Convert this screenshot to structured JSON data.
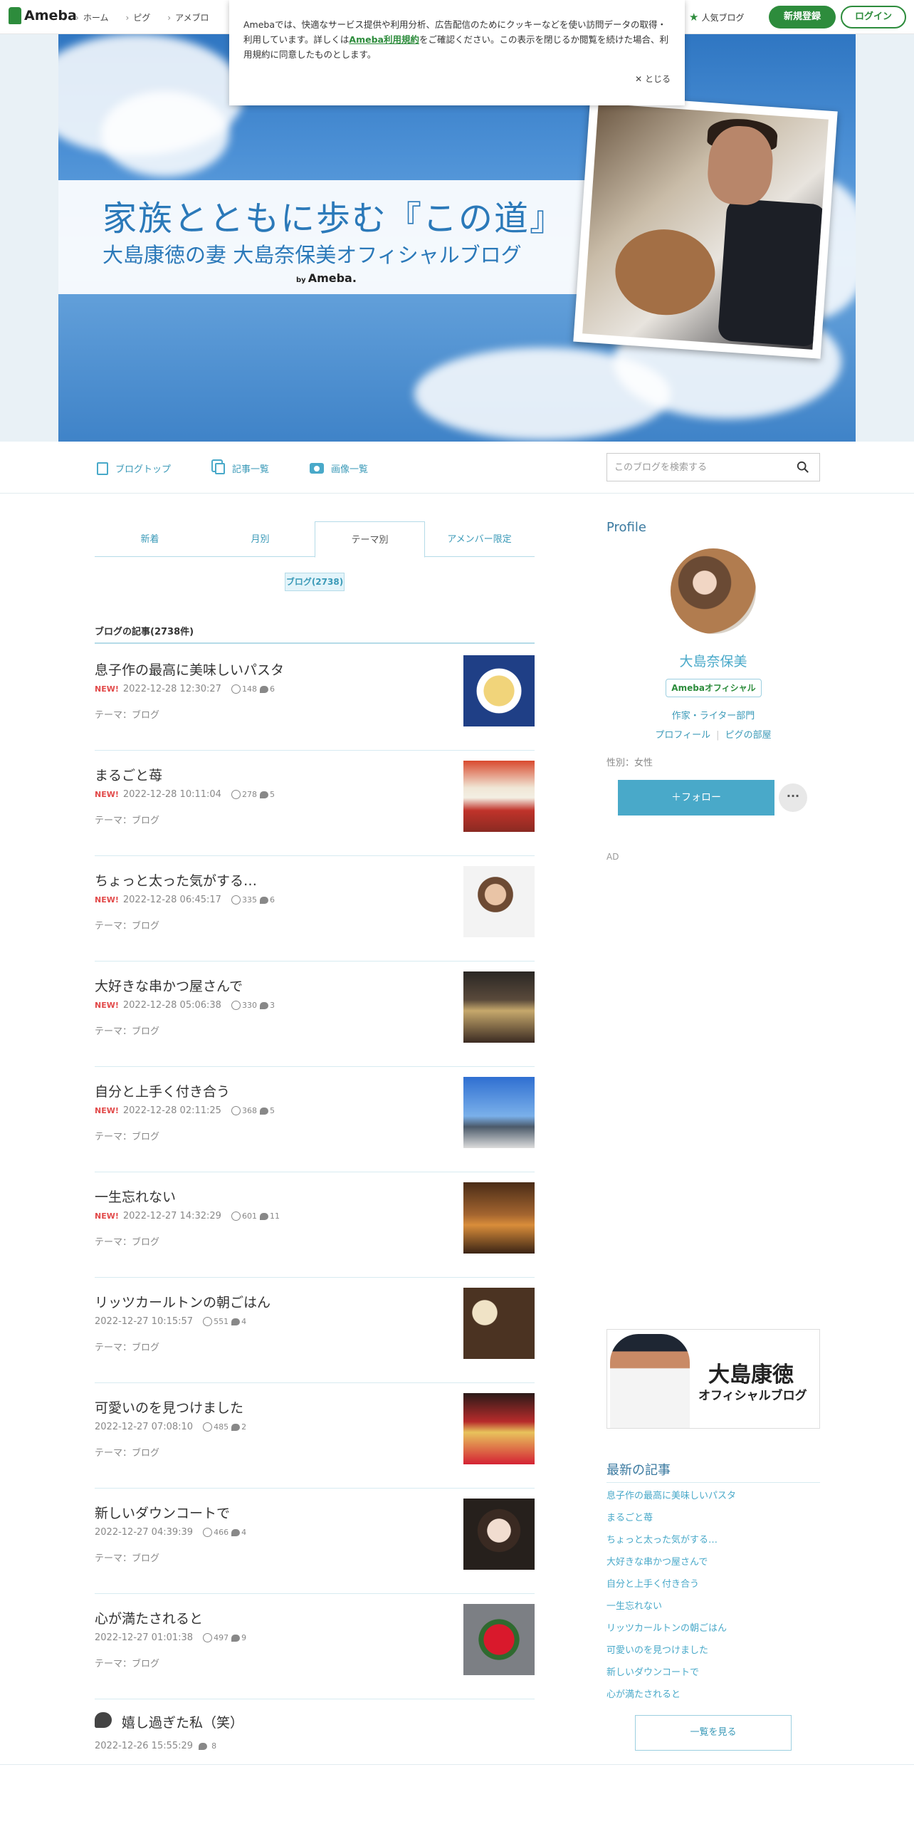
{
  "topbar": {
    "logo": "Ameba",
    "nav": [
      "ホーム",
      "ピグ",
      "アメブロ"
    ],
    "popular": "人気ブログ",
    "register": "新規登録",
    "login": "ログイン"
  },
  "cookie": {
    "text_before": "Amebaでは、快適なサービス提供や利用分析、広告配信のためにクッキーなどを使い訪問データの取得・利用しています。詳しくは",
    "link": "Ameba利用規約",
    "text_after": "をご確認ください。この表示を閉じるか閲覧を続けた場合、利用規約に同意したものとします。",
    "close": "✕ とじる"
  },
  "banner": {
    "title": "家族とともに歩む『この道』",
    "subtitle": "大島康徳の妻 大島奈保美オフィシャルブログ",
    "by_small": "by",
    "by": "Ameba."
  },
  "blognav": {
    "top": "ブログトップ",
    "list": "記事一覧",
    "images": "画像一覧",
    "search_placeholder": "このブログを検索する"
  },
  "tabs": [
    "新着",
    "月別",
    "テーマ別",
    "アメンバー限定"
  ],
  "theme_chip": "ブログ(2738)",
  "list_heading": "ブログの記事(2738件)",
  "new_label": "NEW!",
  "theme_label": "テーマ：ブログ",
  "articles": [
    {
      "title": "息子作の最高に美味しいパスタ",
      "new": true,
      "date": "2022-12-28 12:30:27",
      "likes": "148",
      "comments": "6"
    },
    {
      "title": "まるごと苺",
      "new": true,
      "date": "2022-12-28 10:11:04",
      "likes": "278",
      "comments": "5"
    },
    {
      "title": "ちょっと太った気がする…",
      "new": true,
      "date": "2022-12-28 06:45:17",
      "likes": "335",
      "comments": "6"
    },
    {
      "title": "大好きな串かつ屋さんで",
      "new": true,
      "date": "2022-12-28 05:06:38",
      "likes": "330",
      "comments": "3"
    },
    {
      "title": "自分と上手く付き合う",
      "new": true,
      "date": "2022-12-28 02:11:25",
      "likes": "368",
      "comments": "5"
    },
    {
      "title": "一生忘れない",
      "new": true,
      "date": "2022-12-27 14:32:29",
      "likes": "601",
      "comments": "11"
    },
    {
      "title": "リッツカールトンの朝ごはん",
      "new": false,
      "date": "2022-12-27 10:15:57",
      "likes": "551",
      "comments": "4"
    },
    {
      "title": "可愛いのを見つけました",
      "new": false,
      "date": "2022-12-27 07:08:10",
      "likes": "485",
      "comments": "2"
    },
    {
      "title": "新しいダウンコートで",
      "new": false,
      "date": "2022-12-27 04:39:39",
      "likes": "466",
      "comments": "4"
    },
    {
      "title": "心が満たされると",
      "new": false,
      "date": "2022-12-27 01:01:38",
      "likes": "497",
      "comments": "9"
    }
  ],
  "reblog": {
    "title": "嬉し過ぎた私（笑）",
    "date": "2022-12-26 15:55:29",
    "comments": "8"
  },
  "sidebar": {
    "profile_heading": "Profile",
    "name": "大島奈保美",
    "badge": "Amebaオフィシャル",
    "category": "作家・ライター部門",
    "link_profile": "プロフィール",
    "link_room": "ピグの部屋",
    "sex": "性別：女性",
    "follow": "＋フォロー",
    "more": "···",
    "ad": "AD",
    "hub_name": "大島康徳",
    "hub_sub": "オフィシャルブログ",
    "recent_heading": "最新の記事",
    "see_all": "一覧を見る"
  }
}
